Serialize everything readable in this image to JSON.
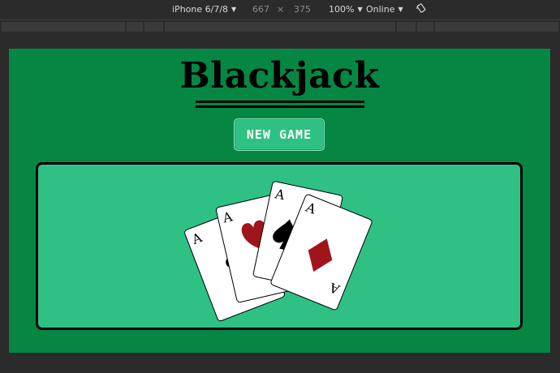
{
  "devtools": {
    "device": "iPhone 6/7/8",
    "width": "667",
    "times": "×",
    "height": "375",
    "zoom": "100%",
    "network": "Online"
  },
  "page": {
    "title": "Blackjack",
    "new_game_label": "NEW GAME"
  },
  "cards": [
    {
      "rank": "A",
      "suit": "clubs",
      "color": "#000000"
    },
    {
      "rank": "A",
      "suit": "hearts",
      "color": "#a0151b"
    },
    {
      "rank": "A",
      "suit": "spades",
      "color": "#000000"
    },
    {
      "rank": "A",
      "suit": "diamonds",
      "color": "#a0151b"
    }
  ],
  "colors": {
    "page_bg": "#058743",
    "table_felt": "#2ec183",
    "button_bg": "#2ec183",
    "suit_red": "#a0151b"
  }
}
